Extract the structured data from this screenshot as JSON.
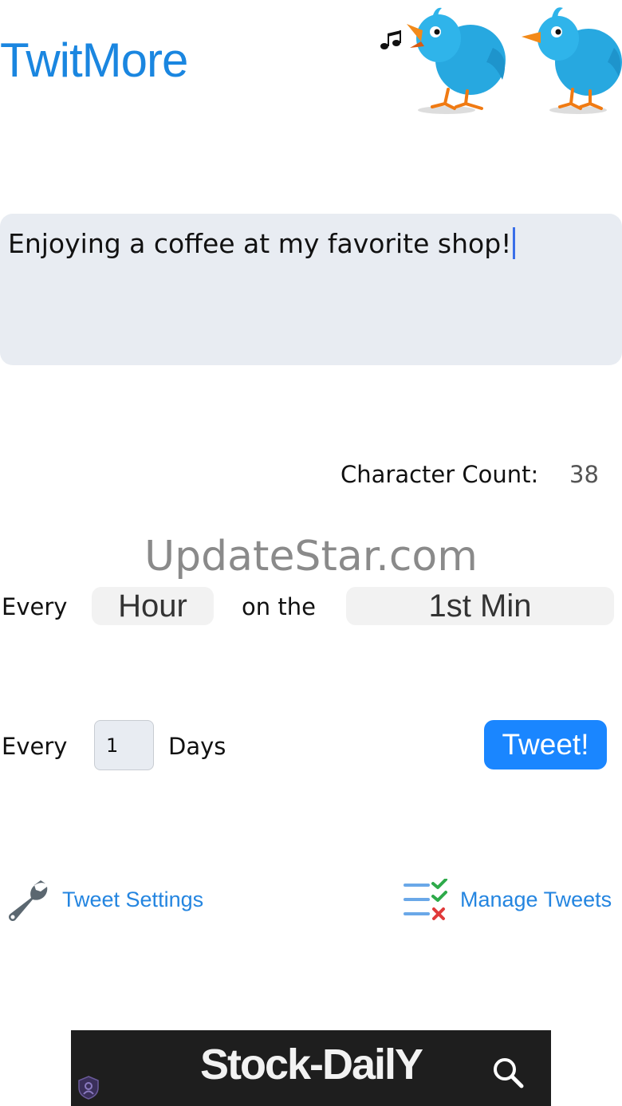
{
  "app": {
    "title": "TwitMore",
    "accent_color": "#1a86e0",
    "header_icon": "singing-birds-icon"
  },
  "composer": {
    "text": "Enjoying a coffee at my favorite shop!"
  },
  "character_count": {
    "label": "Character Count:",
    "value": "38"
  },
  "watermark": "UpdateStar.com",
  "schedule": {
    "row1": {
      "every_label": "Every",
      "period_value": "Hour",
      "on_the_label": "on the",
      "minute_value": "1st Min"
    },
    "row2": {
      "every_label": "Every",
      "days_value": "1",
      "days_label": "Days"
    },
    "tweet_button": "Tweet!",
    "button_color": "#1a86ff"
  },
  "links": {
    "settings": {
      "label": "Tweet Settings",
      "icon": "wrench-icon"
    },
    "manage": {
      "label": "Manage Tweets",
      "icon": "checklist-icon"
    }
  },
  "ad": {
    "text": "Stock-DailY",
    "icons": [
      "search-icon",
      "shield-icon"
    ]
  }
}
